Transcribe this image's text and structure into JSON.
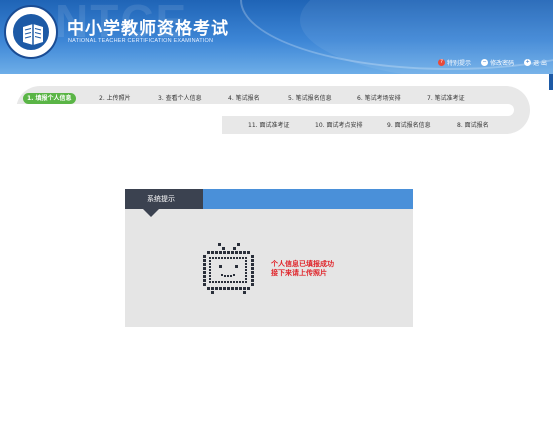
{
  "header": {
    "title": "中小学教师资格考试",
    "subtitle": "NATIONAL TEACHER CERTIFICATION EXAMINATION",
    "watermark": "NTCE",
    "links": [
      {
        "label": "特别提示",
        "icon": "question-icon"
      },
      {
        "label": "修改密码",
        "icon": "minus-icon"
      },
      {
        "label": "退 出",
        "icon": "plus-icon"
      }
    ]
  },
  "steps": [
    {
      "label": "1. 填报个人信息",
      "active": true
    },
    {
      "label": "2. 上传照片"
    },
    {
      "label": "3. 查看个人信息"
    },
    {
      "label": "4. 笔试报名"
    },
    {
      "label": "5. 笔试报名信息"
    },
    {
      "label": "6. 笔试考场安排"
    },
    {
      "label": "7. 笔试准考证"
    },
    {
      "label": "11. 面试准考证"
    },
    {
      "label": "10. 面试考点安排"
    },
    {
      "label": "9. 面试报名信息"
    },
    {
      "label": "8. 面试报名"
    }
  ],
  "panel": {
    "title": "系统提示",
    "message_line1": "个人信息已填报成功",
    "message_line2": "接下来请上传照片",
    "icon": "tv-icon"
  },
  "colors": {
    "header_blue": "#2b6fc3",
    "active_step": "#5ab546",
    "panel_tab": "#3b4250",
    "panel_head": "#4a90d9",
    "message_red": "#e0242a"
  }
}
